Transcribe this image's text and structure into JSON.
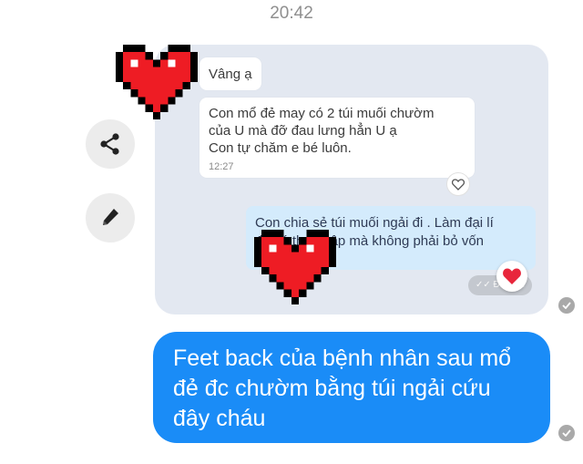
{
  "header": {
    "time": "20:42"
  },
  "forwarded_message": {
    "messages": [
      {
        "text": "Vâng ạ"
      },
      {
        "lines": [
          "Con mổ đẻ may có 2 túi muối chườm",
          "của U mà đỡ đau lưng hẳn U ạ",
          "Con tự chăm e bé luôn."
        ],
        "timestamp": "12:27"
      },
      {
        "lines": [
          "Con chia sẻ túi muối ngải đi . Làm đại lí",
          "để có thu nhập mà không phải bỏ vốn"
        ],
        "status_text": "Đã xem"
      }
    ]
  },
  "actions": {
    "share_icon": "share-icon",
    "edit_icon": "pencil-icon"
  },
  "sent_message": {
    "lines": [
      "Feet back của bệnh nhân sau mổ",
      "đẻ đc chườm bằng túi ngải cứu",
      "đây cháu"
    ]
  },
  "colors": {
    "sent_bubble": "#1a8cf7",
    "forward_card": "#e3e8f1",
    "outgoing_inner_bubble": "#d4ebfc",
    "heart": "#ee1c24",
    "reaction_heart": "#e8263c"
  }
}
